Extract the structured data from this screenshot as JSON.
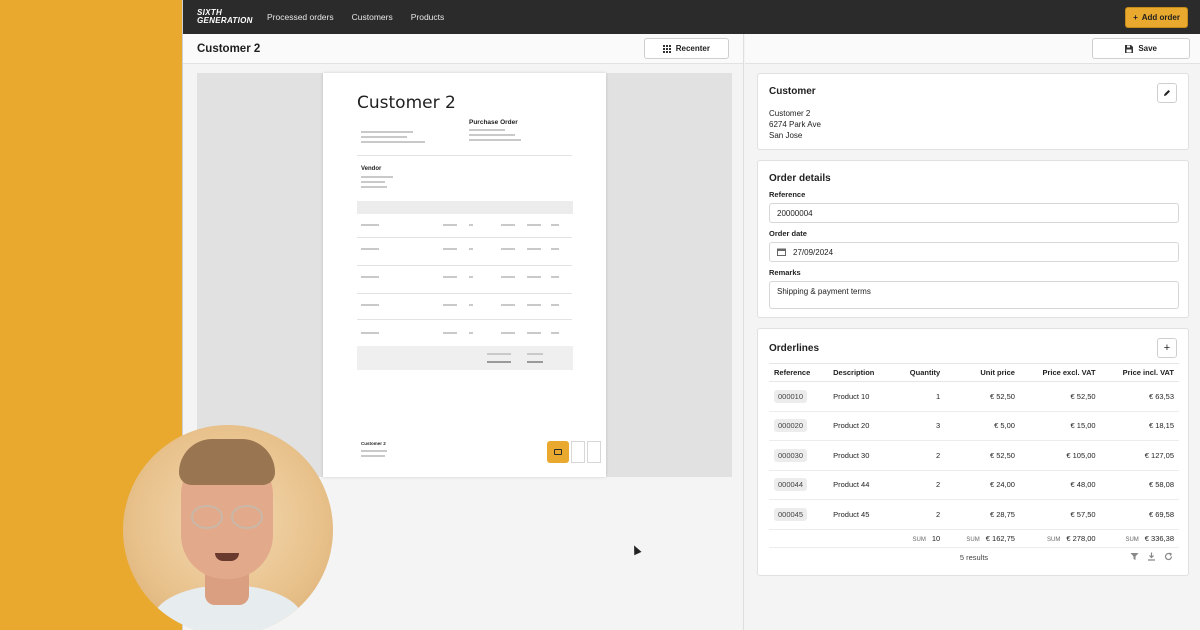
{
  "app": {
    "logo": "SIXTH GENERATION",
    "nav": [
      "Processed orders",
      "Customers",
      "Products"
    ],
    "add_order_label": "Add order"
  },
  "left": {
    "title": "Customer 2",
    "recenter_label": "Recenter",
    "document": {
      "title": "Customer 2",
      "heading": "Purchase Order",
      "vendor_heading": "Vendor",
      "footer_name": "Customer 2"
    }
  },
  "right": {
    "save_label": "Save",
    "customer": {
      "title": "Customer",
      "address_lines": [
        "Customer 2",
        "6274 Park Ave",
        "San Jose"
      ]
    },
    "order_details": {
      "title": "Order details",
      "reference_label": "Reference",
      "reference_value": "20000004",
      "date_label": "Order date",
      "date_value": "27/09/2024",
      "remarks_label": "Remarks",
      "remarks_value": "Shipping & payment terms"
    },
    "orderlines": {
      "title": "Orderlines",
      "columns": [
        "Reference",
        "Description",
        "Quantity",
        "Unit price",
        "Price excl. VAT",
        "Price incl. VAT"
      ],
      "rows": [
        [
          "000010",
          "Product 10",
          "1",
          "€ 52,50",
          "€ 52,50",
          "€ 63,53"
        ],
        [
          "000020",
          "Product 20",
          "3",
          "€ 5,00",
          "€ 15,00",
          "€ 18,15"
        ],
        [
          "000030",
          "Product 30",
          "2",
          "€ 52,50",
          "€ 105,00",
          "€ 127,05"
        ],
        [
          "000044",
          "Product 44",
          "2",
          "€ 24,00",
          "€ 48,00",
          "€ 58,08"
        ],
        [
          "000045",
          "Product 45",
          "2",
          "€ 28,75",
          "€ 57,50",
          "€ 69,58"
        ]
      ],
      "sum_label": "SUM",
      "sums": {
        "quantity": "10",
        "unit_price": "€ 162,75",
        "excl_vat": "€ 278,00",
        "incl_vat": "€ 336,38"
      },
      "results": "5 results"
    }
  },
  "colors": {
    "accent": "#e9a92e",
    "topbar": "#2b2b2b"
  }
}
